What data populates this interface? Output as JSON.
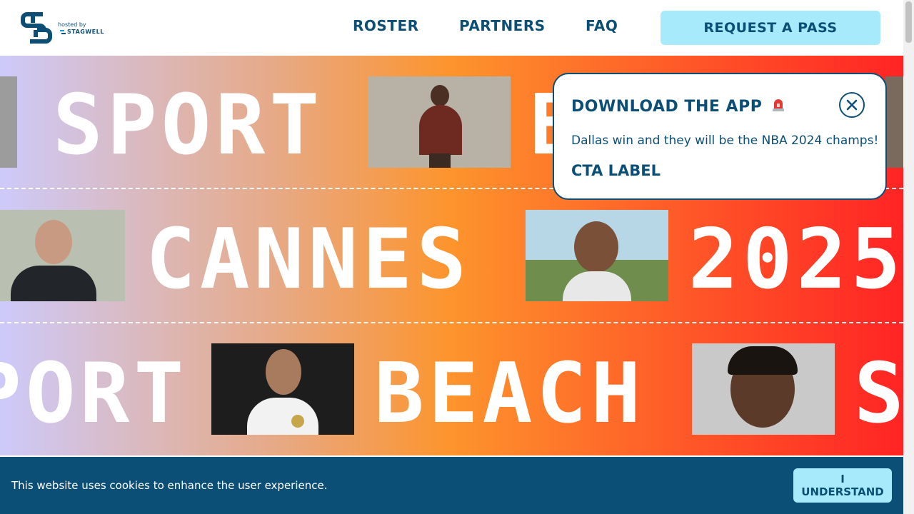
{
  "header": {
    "hosted_by": "hosted by",
    "host_brand": "STAGWELL",
    "nav": [
      {
        "label": "ROSTER"
      },
      {
        "label": "PARTNERS"
      },
      {
        "label": "FAQ"
      }
    ],
    "cta_label": "REQUEST A PASS"
  },
  "hero": {
    "row1_words": [
      "SPORT",
      "B"
    ],
    "row2_words": [
      "CANNES",
      "2025"
    ],
    "row3_words": [
      "PORT",
      "BEACH",
      "S"
    ]
  },
  "popup": {
    "title": "DOWNLOAD THE APP",
    "title_icon": "siren-icon",
    "message": "Dallas win and they will be the NBA 2024 champs!",
    "cta_label": "CTA LABEL"
  },
  "cookie_bar": {
    "message": "This website uses cookies to enhance the user experience.",
    "button_label": "I UNDERSTAND"
  },
  "colors": {
    "brand_navy": "#0b4f77",
    "accent_cyan": "#a6eafc",
    "gradient_start": "#cdcafa",
    "gradient_mid": "#fd942c",
    "gradient_end": "#ff2424"
  }
}
